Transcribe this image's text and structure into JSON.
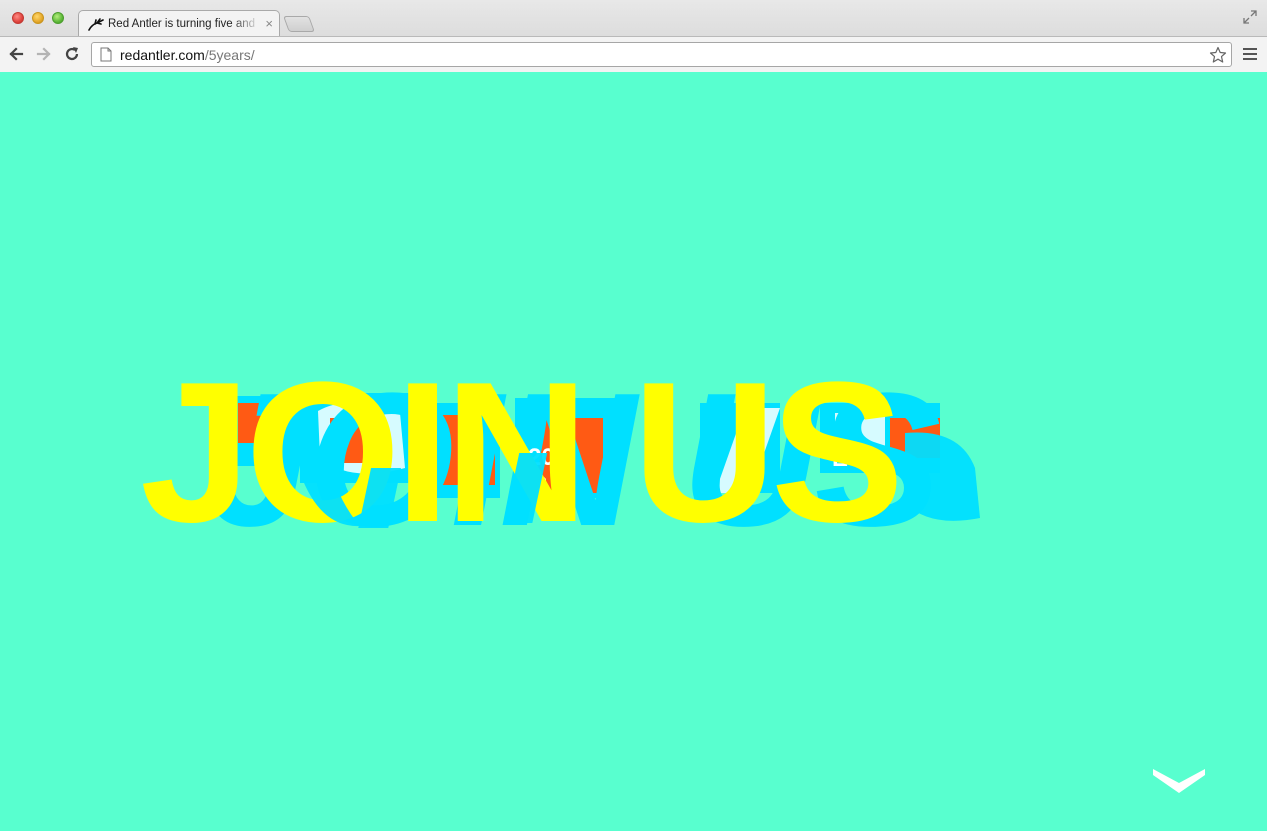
{
  "browser": {
    "tab_title": "Red Antler is turning five and",
    "tab_close": "×",
    "url_host": "redantler.com",
    "url_path": "/5years/",
    "icons": {
      "favicon": "antler-icon",
      "back": "back-arrow-icon",
      "forward": "forward-arrow-icon",
      "reload": "reload-icon",
      "page": "page-icon",
      "star": "star-icon",
      "menu": "hamburger-menu-icon",
      "fullscreen": "fullscreen-icon"
    }
  },
  "hero": {
    "headline": "JOIN US",
    "background_color": "#58ffcf",
    "colors": {
      "yellow": "#ffff00",
      "cyan": "#00e0ff",
      "orange": "#ff5a14",
      "pale": "#d6fbff"
    },
    "fragments": [
      "20",
      "B",
      "E"
    ]
  },
  "scroll": {
    "icon": "chevron-down-icon"
  }
}
